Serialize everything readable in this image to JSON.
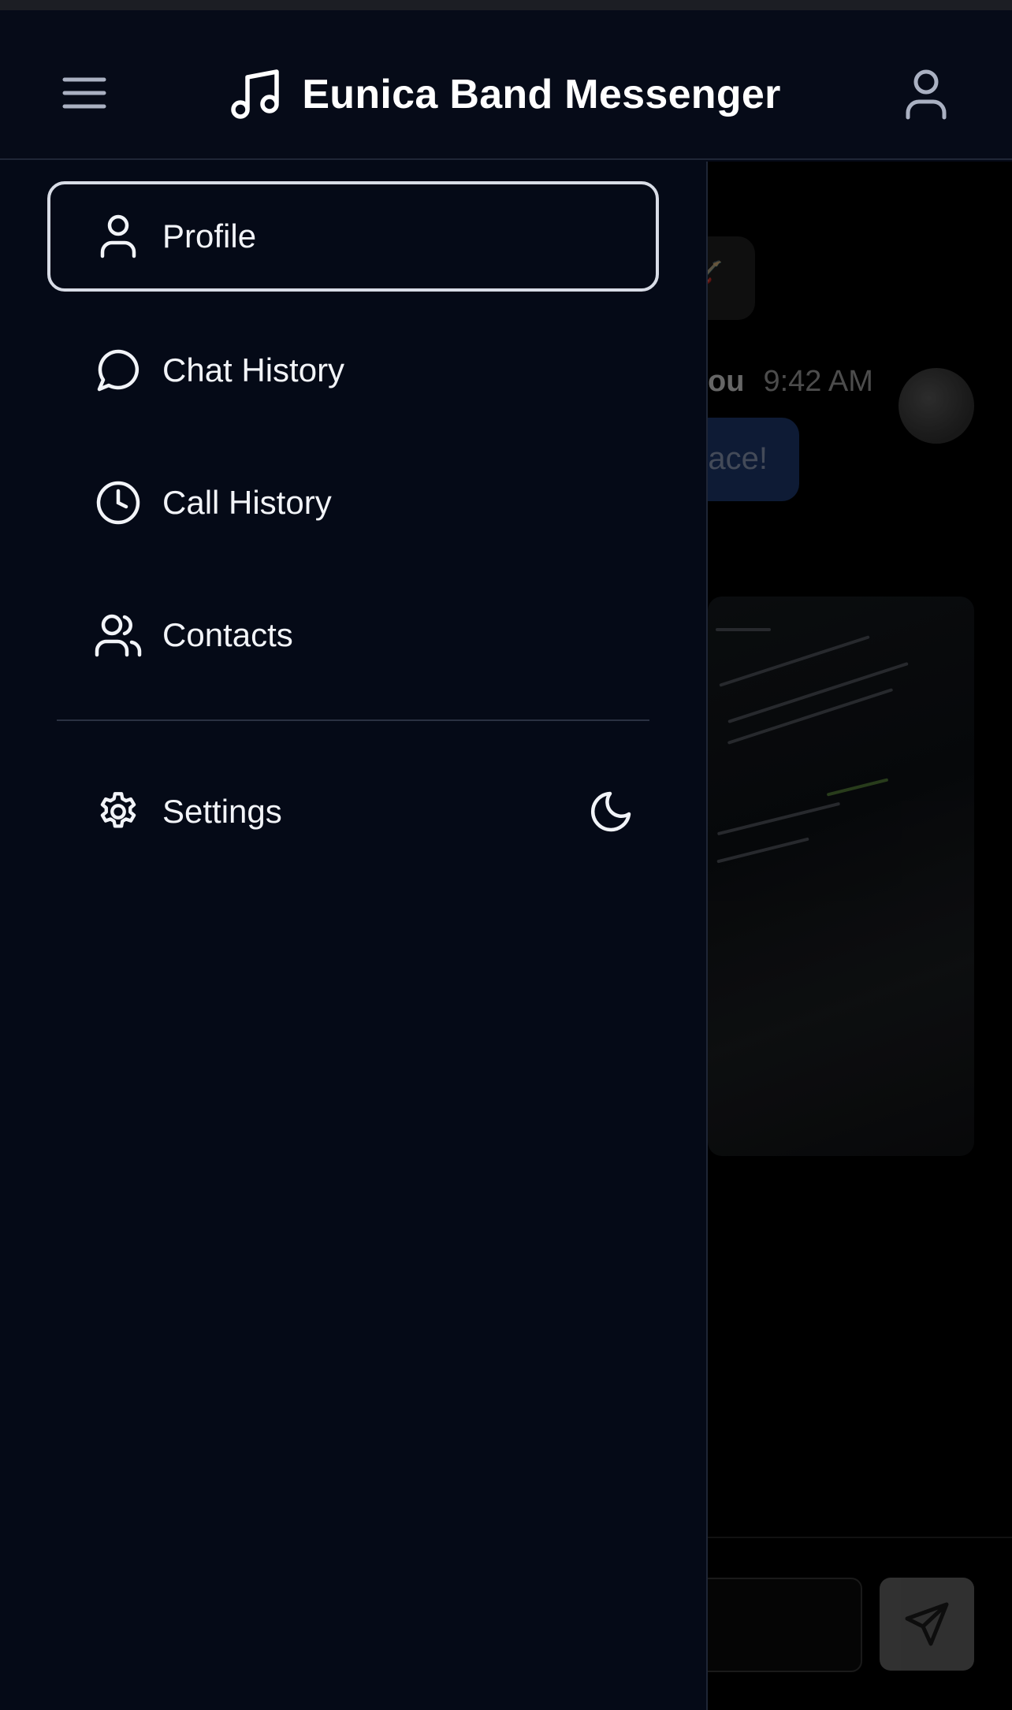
{
  "header": {
    "title": "Eunica Band Messenger",
    "menu_icon": "hamburger-menu-icon",
    "logo_icon": "music-note-icon",
    "profile_icon": "user-icon"
  },
  "drawer": {
    "items": [
      {
        "label": "Profile",
        "icon": "user-icon",
        "active": true
      },
      {
        "label": "Chat History",
        "icon": "chat-bubble-icon",
        "active": false
      },
      {
        "label": "Call History",
        "icon": "clock-icon",
        "active": false
      },
      {
        "label": "Contacts",
        "icon": "users-icon",
        "active": false
      }
    ],
    "settings": {
      "label": "Settings",
      "icon": "gear-icon"
    },
    "theme_toggle_icon": "moon-icon"
  },
  "background_chat": {
    "incoming_fragment": "e? 🎸",
    "sender_fragment": "ou",
    "time": "9:42 AM",
    "outgoing_fragment": "ual place!",
    "send_icon": "send-icon"
  },
  "colors": {
    "background": "#050a17",
    "header": "#060b18",
    "active_border": "#d8dce6",
    "outgoing_bubble": "#1e3a6e"
  }
}
